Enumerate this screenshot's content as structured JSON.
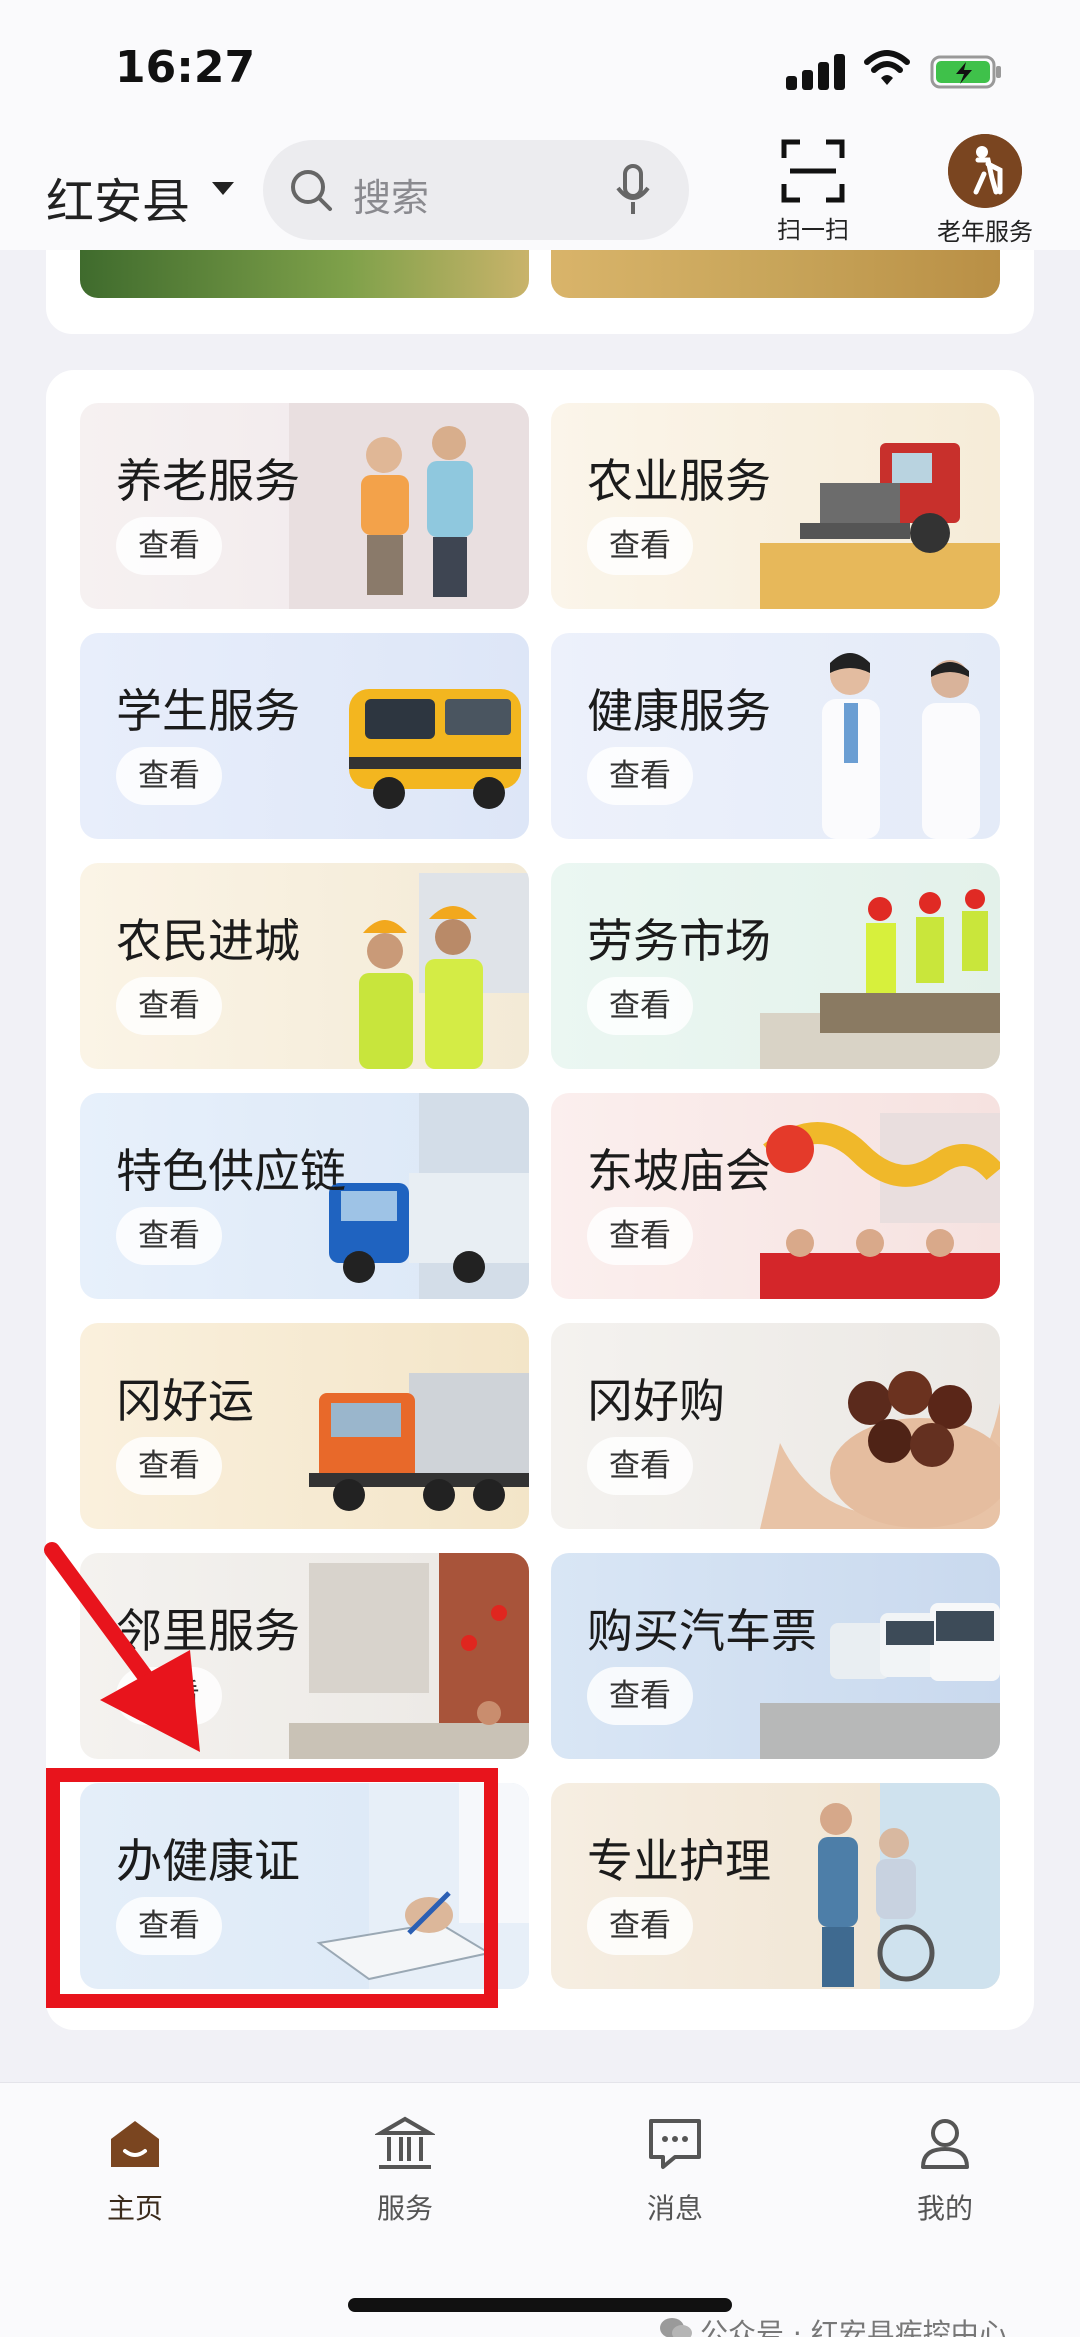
{
  "status": {
    "time": "16:27"
  },
  "header": {
    "location": "红安县",
    "search_placeholder": "搜索",
    "scan_label": "扫一扫",
    "senior_label": "老年服务"
  },
  "tiles": [
    {
      "title": "养老服务",
      "button": "查看"
    },
    {
      "title": "农业服务",
      "button": "查看"
    },
    {
      "title": "学生服务",
      "button": "查看"
    },
    {
      "title": "健康服务",
      "button": "查看"
    },
    {
      "title": "农民进城",
      "button": "查看"
    },
    {
      "title": "劳务市场",
      "button": "查看"
    },
    {
      "title": "特色供应链",
      "button": "查看"
    },
    {
      "title": "东坡庙会",
      "button": "查看"
    },
    {
      "title": "冈好运",
      "button": "查看"
    },
    {
      "title": "冈好购",
      "button": "查看"
    },
    {
      "title": "邻里服务",
      "button": "查看"
    },
    {
      "title": "购买汽车票",
      "button": "查看"
    },
    {
      "title": "办健康证",
      "button": "查看"
    },
    {
      "title": "专业护理",
      "button": "查看"
    }
  ],
  "nav": {
    "home": "主页",
    "services": "服务",
    "messages": "消息",
    "mine": "我的"
  },
  "watermark": "公众号 · 红安县疾控中心",
  "colors": {
    "accent": "#7a4520",
    "highlight": "#e8141c"
  }
}
